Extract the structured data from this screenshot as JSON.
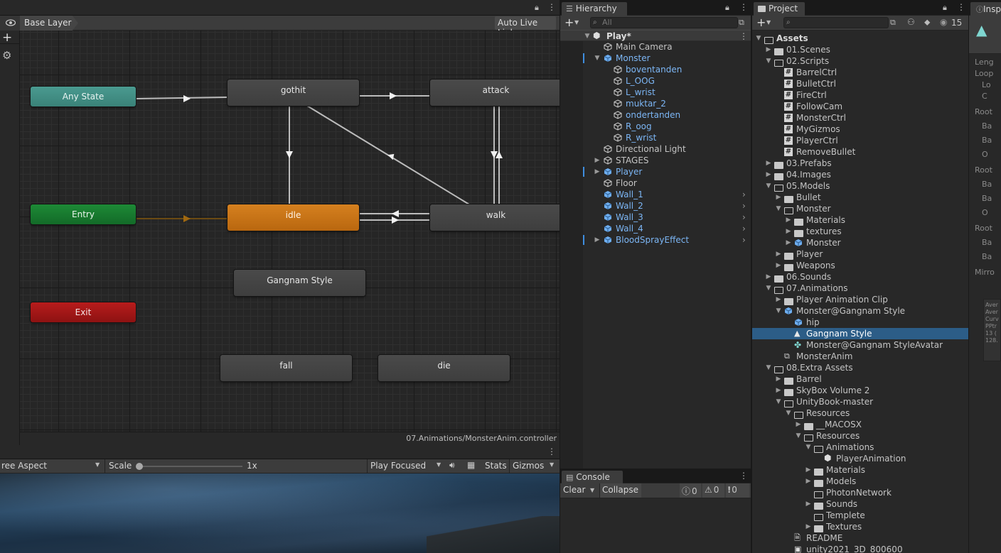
{
  "animator": {
    "layer_name": "Base Layer",
    "auto_live_link": "Auto Live Link",
    "controller_path": "07.Animations/MonsterAnim.controller",
    "states": {
      "any_state": "Any State",
      "entry": "Entry",
      "exit": "Exit",
      "gothit": "gothit",
      "attack": "attack",
      "idle": "idle",
      "walk": "walk",
      "gangnam": "Gangnam Style",
      "fall": "fall",
      "die": "die"
    },
    "colors": {
      "any_state": "#3f8f86",
      "entry": "#14742c",
      "exit": "#a01515",
      "default": "#c87018",
      "state": "#454545"
    }
  },
  "game": {
    "aspect": "ree Aspect",
    "scale_label": "Scale",
    "scale_value": "1x",
    "play_mode": "Play Focused",
    "stats": "Stats",
    "gizmos": "Gizmos"
  },
  "hierarchy": {
    "tab": "Hierarchy",
    "search_placeholder": "All",
    "scene": "Play*",
    "items": [
      {
        "label": "Main Camera"
      },
      {
        "label": "Monster"
      },
      {
        "label": "boventanden"
      },
      {
        "label": "L_OOG"
      },
      {
        "label": "L_wrist"
      },
      {
        "label": "muktar_2"
      },
      {
        "label": "ondertanden"
      },
      {
        "label": "R_oog"
      },
      {
        "label": "R_wrist"
      },
      {
        "label": "Directional Light"
      },
      {
        "label": "STAGES"
      },
      {
        "label": "Player"
      },
      {
        "label": "Floor"
      },
      {
        "label": "Wall_1"
      },
      {
        "label": "Wall_2"
      },
      {
        "label": "Wall_3"
      },
      {
        "label": "Wall_4"
      },
      {
        "label": "BloodSprayEffect"
      }
    ]
  },
  "console": {
    "tab": "Console",
    "clear": "Clear",
    "collapse": "Collapse",
    "info_count": "0",
    "warn_count": "0",
    "error_count": "0"
  },
  "project": {
    "tab": "Project",
    "hidden_count": "15",
    "items": [
      {
        "label": "Assets"
      },
      {
        "label": "01.Scenes"
      },
      {
        "label": "02.Scripts"
      },
      {
        "label": "BarrelCtrl"
      },
      {
        "label": "BulletCtrl"
      },
      {
        "label": "FireCtrl"
      },
      {
        "label": "FollowCam"
      },
      {
        "label": "MonsterCtrl"
      },
      {
        "label": "MyGizmos"
      },
      {
        "label": "PlayerCtrl"
      },
      {
        "label": "RemoveBullet"
      },
      {
        "label": "03.Prefabs"
      },
      {
        "label": "04.Images"
      },
      {
        "label": "05.Models"
      },
      {
        "label": "Bullet"
      },
      {
        "label": "Monster"
      },
      {
        "label": "Materials"
      },
      {
        "label": "textures"
      },
      {
        "label": "Monster"
      },
      {
        "label": "Player"
      },
      {
        "label": "Weapons"
      },
      {
        "label": "06.Sounds"
      },
      {
        "label": "07.Animations"
      },
      {
        "label": "Player Animation Clip"
      },
      {
        "label": "Monster@Gangnam Style"
      },
      {
        "label": "hip"
      },
      {
        "label": "Gangnam Style"
      },
      {
        "label": "Monster@Gangnam StyleAvatar"
      },
      {
        "label": "MonsterAnim"
      },
      {
        "label": "08.Extra Assets"
      },
      {
        "label": "Barrel"
      },
      {
        "label": "SkyBox Volume 2"
      },
      {
        "label": "UnityBook-master"
      },
      {
        "label": "Resources"
      },
      {
        "label": "__MACOSX"
      },
      {
        "label": "Resources"
      },
      {
        "label": "Animations"
      },
      {
        "label": "PlayerAnimation"
      },
      {
        "label": "Materials"
      },
      {
        "label": "Models"
      },
      {
        "label": "PhotonNetwork"
      },
      {
        "label": "Sounds"
      },
      {
        "label": "Templete"
      },
      {
        "label": "Textures"
      },
      {
        "label": "README"
      },
      {
        "label": "unity2021_3D_800600"
      }
    ]
  },
  "inspector": {
    "tab": "Insp",
    "labels": [
      "Leng",
      "Loop",
      "Lo",
      "C",
      "Root",
      "Ba",
      "Ba",
      "O",
      "Root",
      "Ba",
      "Ba",
      "O",
      "Root",
      "Ba",
      "Ba",
      "Mirro"
    ],
    "info": [
      "Aver",
      "Aver",
      "Curv",
      "PPtr",
      "13 (",
      "128."
    ]
  }
}
